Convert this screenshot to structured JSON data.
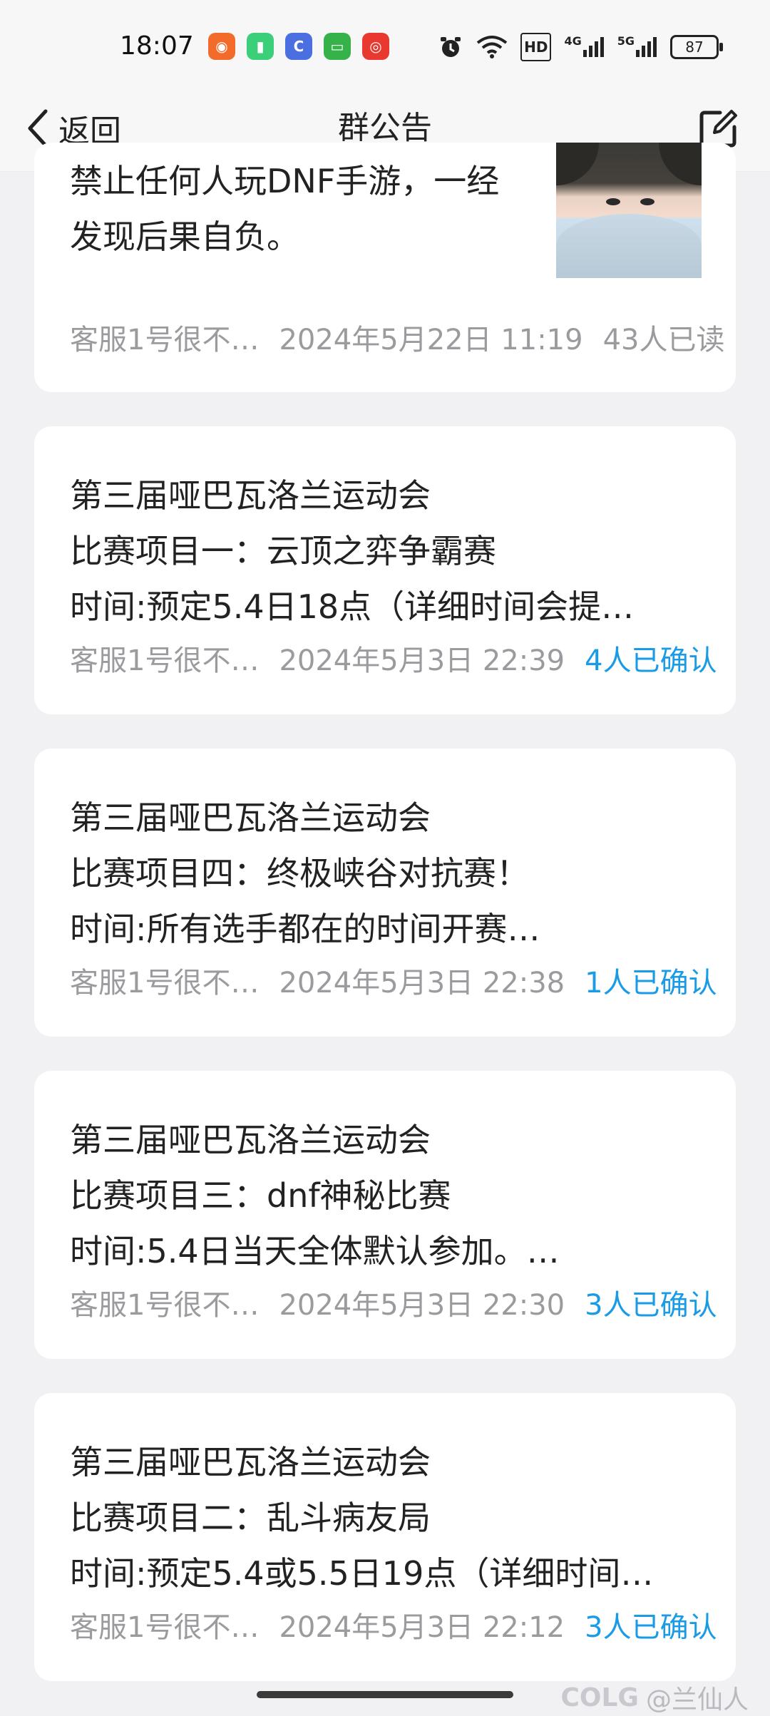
{
  "status_bar": {
    "time": "18:07",
    "network_labels": [
      "HD",
      "4G",
      "5G"
    ],
    "battery": "87"
  },
  "header": {
    "back_label": "返回",
    "title": "群公告"
  },
  "announcements": [
    {
      "lines": [
        "禁止任何人玩DNF手游，一经",
        "发现后果自负。"
      ],
      "author": "客服1号很不…",
      "datetime": "2024年5月22日 11:19",
      "status": "43人已读",
      "status_type": "read",
      "has_image": true
    },
    {
      "lines": [
        "第三届哑巴瓦洛兰运动会",
        "比赛项目一：云顶之弈争霸赛",
        "时间:预定5.4日18点（详细时间会提…"
      ],
      "author": "客服1号很不…",
      "datetime": "2024年5月3日 22:39",
      "status": "4人已确认",
      "status_type": "confirm"
    },
    {
      "lines": [
        "第三届哑巴瓦洛兰运动会",
        "比赛项目四：终极峡谷对抗赛！",
        "时间:所有选手都在的时间开赛…"
      ],
      "author": "客服1号很不…",
      "datetime": "2024年5月3日 22:38",
      "status": "1人已确认",
      "status_type": "confirm"
    },
    {
      "lines": [
        "第三届哑巴瓦洛兰运动会",
        "比赛项目三：dnf神秘比赛",
        "时间:5.4日当天全体默认参加。…"
      ],
      "author": "客服1号很不…",
      "datetime": "2024年5月3日 22:30",
      "status": "3人已确认",
      "status_type": "confirm"
    },
    {
      "lines": [
        "第三届哑巴瓦洛兰运动会",
        "比赛项目二：乱斗病友局",
        "时间:预定5.4或5.5日19点（详细时间…"
      ],
      "author": "客服1号很不…",
      "datetime": "2024年5月3日 22:12",
      "status": "3人已确认",
      "status_type": "confirm"
    }
  ],
  "watermark": {
    "logo": "COLG",
    "text": "@兰仙人"
  },
  "colors": {
    "accent": "#1a9be6",
    "meta": "#9b9b9f",
    "background": "#f1f1f4"
  }
}
